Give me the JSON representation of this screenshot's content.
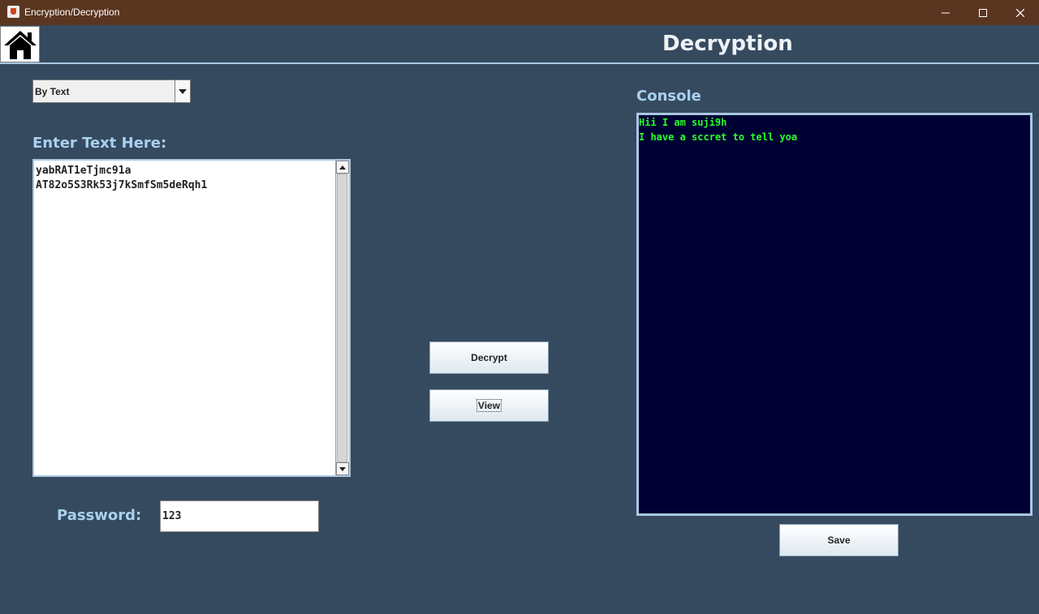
{
  "window": {
    "title": "Encryption/Decryption",
    "icon": "java-cup-icon",
    "controls": [
      "minimize-icon",
      "maximize-icon",
      "close-icon"
    ]
  },
  "header": {
    "home_icon": "home-icon",
    "title": "Decryption"
  },
  "input_panel": {
    "mode_select": {
      "value": "By Text"
    },
    "label": "Enter Text Here:",
    "text_lines": [
      "yabRAT1eTjmc91a",
      "AT82o5S3Rk53j7kSmfSm5deRqh1"
    ]
  },
  "password": {
    "label": "Password:",
    "value": "123"
  },
  "actions": {
    "decrypt_label": "Decrypt",
    "view_label": "View"
  },
  "console": {
    "label": "Console",
    "lines": [
      "Hii I am suji9h",
      "I have a sccret to tell yoa"
    ],
    "save_label": "Save"
  },
  "colors": {
    "background": "#364a5f",
    "titlebar": "#5a3620",
    "label": "#a9d1ef",
    "console_bg": "#000033",
    "console_text": "#2aff2a"
  }
}
